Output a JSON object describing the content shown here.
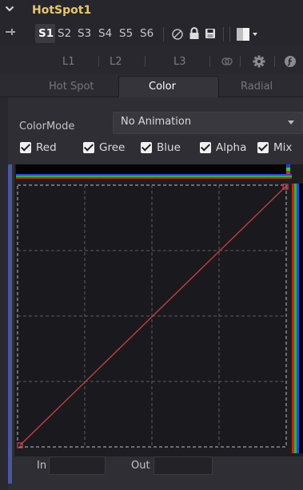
{
  "header": {
    "title": "HotSpot1",
    "collapse_icon": "chevron-down-icon"
  },
  "versions": {
    "items": [
      "S1",
      "S2",
      "S3",
      "S4",
      "S5",
      "S6"
    ],
    "active": "S1"
  },
  "layers": {
    "items": [
      "L1",
      "L2",
      "L3"
    ]
  },
  "tabs": {
    "items": [
      "Hot Spot",
      "Color",
      "Radial"
    ],
    "active": "Color"
  },
  "color_mode": {
    "label": "ColorMode",
    "value": "No Animation"
  },
  "channels": [
    {
      "label": "Red",
      "checked": true
    },
    {
      "label": "Gree",
      "checked": true
    },
    {
      "label": "Blue",
      "checked": true
    },
    {
      "label": "Alpha",
      "checked": true
    },
    {
      "label": "Mix",
      "checked": true
    }
  ],
  "curve": {
    "type": "linear",
    "points": [
      [
        0,
        0
      ],
      [
        1,
        1
      ]
    ],
    "color": "#c8404a"
  },
  "io": {
    "in_label": "In",
    "in_value": "",
    "out_label": "Out",
    "out_value": ""
  },
  "colors": {
    "title": "#e8c86a",
    "selection": "#4d55a0",
    "curve": "#c8404a"
  }
}
